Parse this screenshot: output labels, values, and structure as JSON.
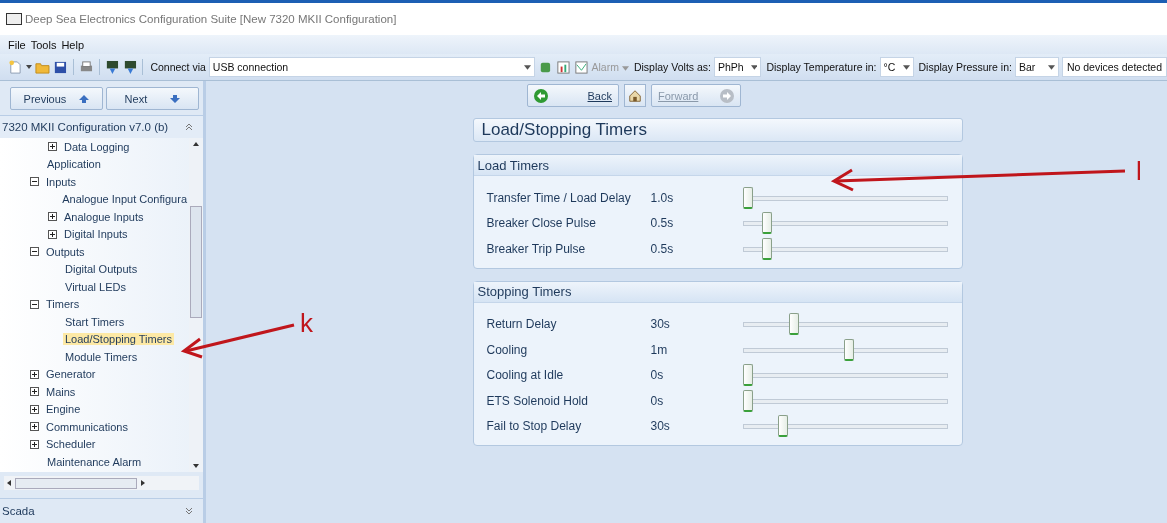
{
  "window": {
    "title": "Deep Sea Electronics Configuration Suite [New 7320 MKII Configuration]"
  },
  "menu": [
    "File",
    "Tools",
    "Help"
  ],
  "toolbar": {
    "connect_label": "Connect via",
    "connect_value": "USB connection",
    "alarm": {
      "label": "Alarm",
      "disabled": true
    },
    "volts_label": "Display Volts as:",
    "volts_value": "PhPh",
    "temp_label": "Display Temperature in:",
    "temp_value": "°C",
    "pressure_label": "Display Pressure in:",
    "pressure_value": "Bar",
    "status": "No devices detected"
  },
  "nav_side": {
    "previous": "Previous",
    "next": "Next"
  },
  "sidebar": {
    "header": "7320 MKII Configuration v7.0 (b)",
    "overflow_children": [
      {
        "label": "Data Logging",
        "expanded": false,
        "selected": false
      }
    ],
    "items": [
      {
        "label": "Application",
        "selected": false
      },
      {
        "label": "Inputs",
        "expanded": true,
        "selected": false,
        "children": [
          {
            "label": "Analogue Input Configura",
            "selected": false
          },
          {
            "label": "Analogue Inputs",
            "expanded": false,
            "selected": false
          },
          {
            "label": "Digital Inputs",
            "expanded": false,
            "selected": false
          }
        ]
      },
      {
        "label": "Outputs",
        "expanded": true,
        "selected": false,
        "children": [
          {
            "label": "Digital Outputs",
            "selected": false
          },
          {
            "label": "Virtual LEDs",
            "selected": false
          }
        ]
      },
      {
        "label": "Timers",
        "expanded": true,
        "selected": false,
        "children": [
          {
            "label": "Start Timers",
            "selected": false
          },
          {
            "label": "Load/Stopping Timers",
            "selected": true
          },
          {
            "label": "Module Timers",
            "selected": false
          }
        ]
      },
      {
        "label": "Generator",
        "expanded": false,
        "selected": false
      },
      {
        "label": "Mains",
        "expanded": false,
        "selected": false
      },
      {
        "label": "Engine",
        "expanded": false,
        "selected": false
      },
      {
        "label": "Communications",
        "expanded": false,
        "selected": false
      },
      {
        "label": "Scheduler",
        "expanded": false,
        "selected": false
      },
      {
        "label": "Maintenance Alarm",
        "selected": false
      }
    ],
    "footer": "Scada"
  },
  "nav_main": {
    "back": {
      "label": "Back",
      "disabled": false
    },
    "forward": {
      "label": "Forward",
      "disabled": true
    }
  },
  "page_title": "Load/Stopping Timers",
  "groups": [
    {
      "title": "Load Timers",
      "rows": [
        {
          "name": "Transfer Time / Load Delay",
          "reading": "1.0s",
          "level": 0
        },
        {
          "name": "Breaker Close Pulse",
          "reading": "0.5s",
          "level": 0.1
        },
        {
          "name": "Breaker Trip Pulse",
          "reading": "0.5s",
          "level": 0.1
        }
      ]
    },
    {
      "title": "Stopping Timers",
      "rows": [
        {
          "name": "Return Delay",
          "reading": "30s",
          "level": 0.24
        },
        {
          "name": "Cooling",
          "reading": "1m",
          "level": 0.52
        },
        {
          "name": "Cooling at Idle",
          "reading": "0s",
          "level": 0
        },
        {
          "name": "ETS Solenoid Hold",
          "reading": "0s",
          "level": 0
        },
        {
          "name": "Fail to Stop Delay",
          "reading": "30s",
          "level": 0.18
        }
      ]
    }
  ],
  "annotations": [
    {
      "label": "k"
    },
    {
      "label": "l"
    }
  ]
}
